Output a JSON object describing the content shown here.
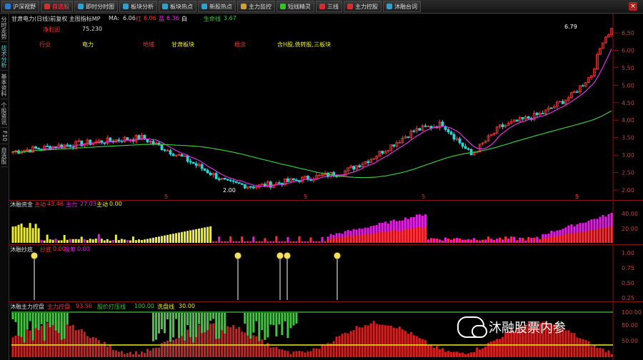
{
  "toolbar": {
    "items": [
      {
        "label": "沪深视野"
      },
      {
        "label": "自选股"
      },
      {
        "label": "即时分时图"
      },
      {
        "label": "板块分析"
      },
      {
        "label": "板块热点"
      },
      {
        "label": "新股热点"
      },
      {
        "label": "主力监控"
      },
      {
        "label": "短线精灵"
      },
      {
        "label": "三线"
      },
      {
        "label": "主力控股"
      },
      {
        "label": "沐融台词"
      }
    ],
    "close_label": "×"
  },
  "sidebar": {
    "tabs": [
      "分时走势",
      "技术分析",
      "基本资料",
      "个股资讯",
      "F10",
      "自选股"
    ]
  },
  "main": {
    "title": "甘肃电力(日线)前复权 主图指标MP",
    "ma_prefix": "MA:",
    "ma_value": "6.06",
    "red_label": "红",
    "red_value": "6.06",
    "blue_label": "蓝",
    "blue_value": "6.36",
    "white_label": "白",
    "green_label": "生命线",
    "green_value": "3.67",
    "net_label": "净利润",
    "net_value": "75.230",
    "industry_label": "行业",
    "industry_value": "电力",
    "region_label": "地域",
    "region_value": "甘肃板块",
    "concept_label": "概念",
    "concept_value": "含H股,债转股,三板块",
    "y_ticks": [
      "6.50",
      "6.00",
      "5.50",
      "5.00",
      "4.50",
      "4.00",
      "3.50",
      "3.00",
      "2.50",
      "2.00"
    ],
    "high_value": "6.79",
    "low_value": "2.00",
    "x_marks": [
      "5",
      "5",
      "5",
      "5",
      "5"
    ]
  },
  "panel2": {
    "name": "沐融资金",
    "a_label": "主动",
    "a_value": "43.46",
    "b_label": "主力",
    "b_value": "27.03",
    "c_label": "主动",
    "c_value": "0.00",
    "y_ticks": [
      "40.00",
      "20.00"
    ]
  },
  "panel3": {
    "name": "沐融抄底",
    "a_label": "抄底",
    "a_value": "0.00",
    "b_label": "吸筹",
    "b_value": "0.00",
    "y_ticks": [
      "1.00",
      "0.75",
      "0.50",
      "0.25"
    ]
  },
  "panel4": {
    "name": "沐融主力控盘",
    "a_label": "主力控盘",
    "a_value": "93.56",
    "b_label": "股价打压线",
    "b_value": "100.00",
    "c_label": "洗盘线",
    "c_value": "30.00",
    "y_ticks": [
      "100.00",
      "80.00",
      "50.00"
    ]
  },
  "watermark": "沐融股票内参",
  "colors": {
    "up": "#ff3030",
    "down": "#2ad4d4",
    "ma_magenta": "#e030e0",
    "life_green": "#3ec83e",
    "yellow": "#f0f020",
    "magenta_bar": "#e020e0"
  }
}
